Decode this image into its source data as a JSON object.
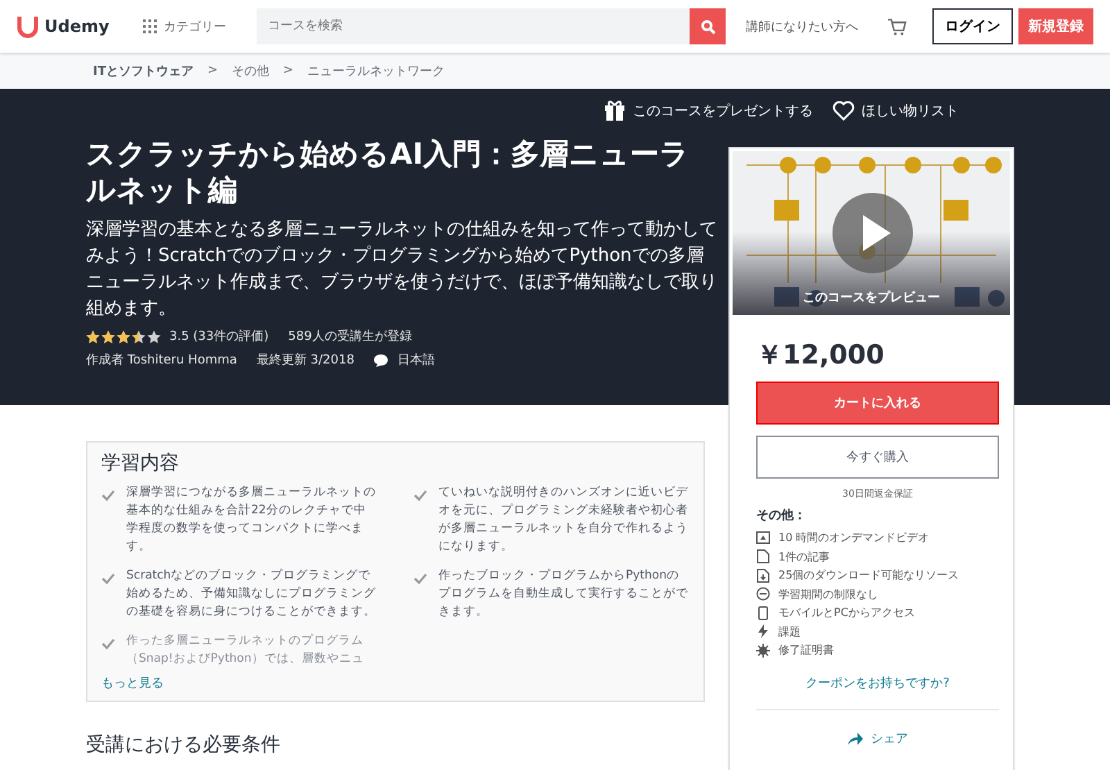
{
  "header": {
    "logo": "Udemy",
    "categories": "カテゴリー",
    "search": {
      "placeholder": "コースを検索"
    },
    "teach": "講師になりたい方へ",
    "login": "ログイン",
    "signup": "新規登録"
  },
  "breadcrumb": [
    "ITとソフトウェア",
    "その他",
    "ニューラルネットワーク"
  ],
  "breadcrumb_separator": ">",
  "hero": {
    "gift": "このコースをプレゼントする",
    "wishlist": "ほしい物リスト",
    "title": "スクラッチから始めるAI入門：多層ニューラルネット編",
    "description": "深層学習の基本となる多層ニューラルネットの仕組みを知って作って動かしてみよう！Scratchでのブロック・プログラミングから始めてPythonでの多層ニューラルネット作成まで、ブラウザを使うだけで、ほぼ予備知識なしで取り組めます。",
    "stars": 3.5,
    "rating": "3.5 (33件の評価)",
    "students": "589人の受講生が登録",
    "author": "作成者 Toshiteru Homma",
    "updated": "最終更新 3/2018",
    "language": "日本語"
  },
  "learn": {
    "title": "学習内容",
    "items": [
      {
        "text": "深層学習につながる多層ニューラルネットの基本的な仕組みを合計22分のレクチャで中学程度の数学を使ってコンパクトに学べます。"
      },
      {
        "text": "ていねいな説明付きのハンズオンに近いビデオを元に、プログラミング未経験者や初心者が多層ニューラルネットを自分で作れるようになります。"
      },
      {
        "text": "Scratchなどのブロック・プログラミングで始めるため、予備知識なしにプログラミングの基礎を容易に身につけることができます。"
      },
      {
        "text": "作ったブロック・プログラムからPythonのプログラムを自動生成して実行することができます。"
      },
      {
        "text": "作った多層ニューラルネットのプログラム（Snap!およびPython）では、層数やニュ"
      }
    ],
    "more": "もっと見る"
  },
  "requirements": {
    "title": "受講における必要条件"
  },
  "sidebar": {
    "preview": "このコースをプレビュー",
    "price": "￥12,000",
    "cart": "カートに入れる",
    "buy": "今すぐ購入",
    "guarantee": "30日間返金保証",
    "includes_title": "その他：",
    "includes": [
      {
        "kind": "video",
        "text": "10 時間のオンデマンドビデオ"
      },
      {
        "kind": "article",
        "text": "1件の記事"
      },
      {
        "kind": "download",
        "text": "25個のダウンロード可能なリソース"
      },
      {
        "kind": "lifetime",
        "text": "学習期間の制限なし"
      },
      {
        "kind": "mobile",
        "text": "モバイルとPCからアクセス"
      },
      {
        "kind": "assignment",
        "text": "課題"
      },
      {
        "kind": "certificate",
        "text": "修了証明書"
      }
    ],
    "coupon": "クーポンをお持ちですか?",
    "share": "シェア"
  }
}
